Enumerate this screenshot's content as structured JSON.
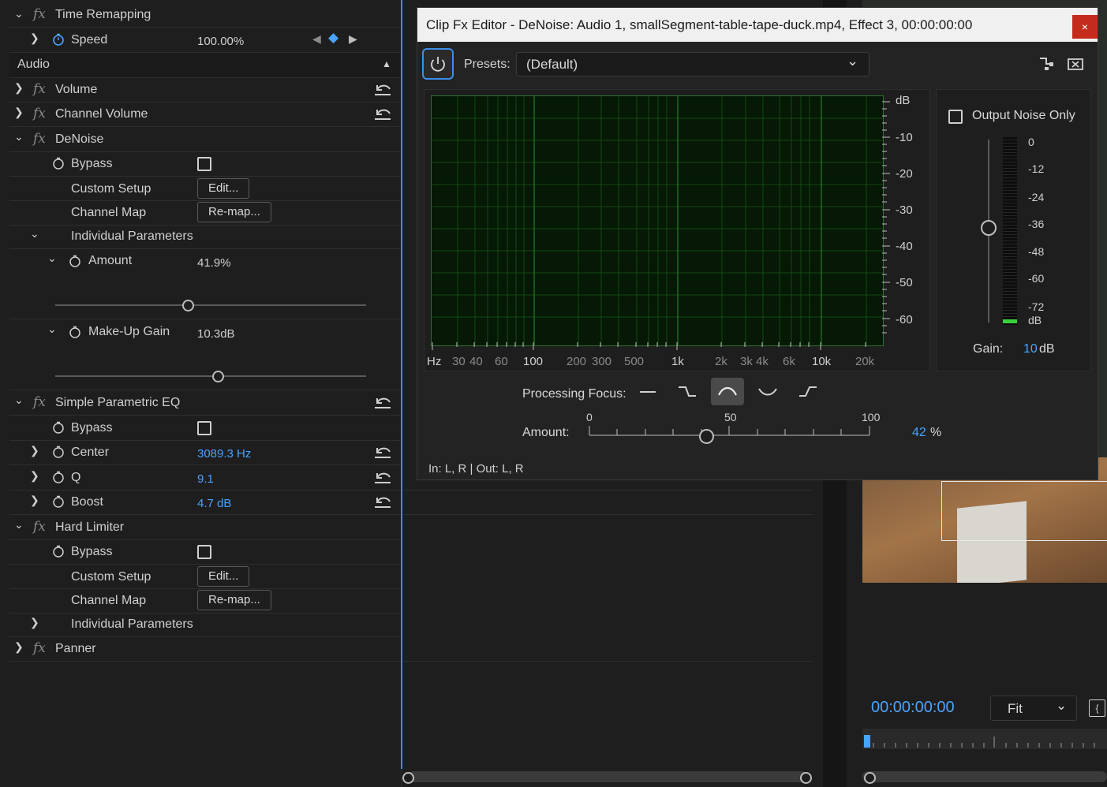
{
  "effects_panel": {
    "time_remapping": "Time Remapping",
    "speed_label": "Speed",
    "speed_value": "100.00%",
    "audio_header": "Audio",
    "volume": "Volume",
    "channel_volume": "Channel Volume",
    "denoise": {
      "name": "DeNoise",
      "bypass": "Bypass",
      "custom_setup": "Custom Setup",
      "edit_btn": "Edit...",
      "channel_map": "Channel Map",
      "remap_btn": "Re-map...",
      "individual_parameters": "Individual Parameters",
      "amount_label": "Amount",
      "amount_value": "41.9%",
      "amount_slider": 0.419,
      "makeup_label": "Make-Up Gain",
      "makeup_value": "10.3dB"
    },
    "eq": {
      "name": "Simple Parametric EQ",
      "bypass": "Bypass",
      "center_label": "Center",
      "center_value": "3089.3 Hz",
      "q_label": "Q",
      "q_value": "9.1",
      "boost_label": "Boost",
      "boost_value": "4.7 dB"
    },
    "limiter": {
      "name": "Hard Limiter",
      "bypass": "Bypass",
      "custom_setup": "Custom Setup",
      "edit_btn": "Edit...",
      "channel_map": "Channel Map",
      "remap_btn": "Re-map...",
      "individual_parameters": "Individual Parameters"
    },
    "panner": "Panner"
  },
  "dialog": {
    "title": "Clip Fx Editor - DeNoise: Audio 1, smallSegment-table-tape-duck.mp4, Effect 3, 00:00:00:00",
    "close": "×",
    "presets_label": "Presets:",
    "presets_value": "(Default)",
    "db_axis": [
      "dB",
      "-10",
      "-20",
      "-30",
      "-40",
      "-50",
      "-60"
    ],
    "hz_axis": [
      "Hz",
      "30",
      "40",
      "60",
      "100",
      "200",
      "300",
      "500",
      "1k",
      "2k",
      "3k",
      "4k",
      "6k",
      "10k",
      "20k"
    ],
    "output_noise_only": "Output Noise Only",
    "meter_scale": [
      "0",
      "-12",
      "-24",
      "-36",
      "-48",
      "-60",
      "-72",
      "dB"
    ],
    "gain_label": "Gain:",
    "gain_value": "10",
    "gain_unit": "dB",
    "processing_focus": "Processing Focus:",
    "amount_label": "Amount:",
    "amount_scale": [
      "0",
      "50",
      "100"
    ],
    "amount_value": "42",
    "amount_unit": "%",
    "amount_fraction": 0.42,
    "io": "In: L, R | Out: L, R"
  },
  "monitor": {
    "timecode": "00:00:00:00",
    "fit": "Fit"
  },
  "colors": {
    "accent": "#4aa3ff",
    "graph_bg": "#061806",
    "graph_grid": "#1c5a1c",
    "close_red": "#c42b1c"
  }
}
